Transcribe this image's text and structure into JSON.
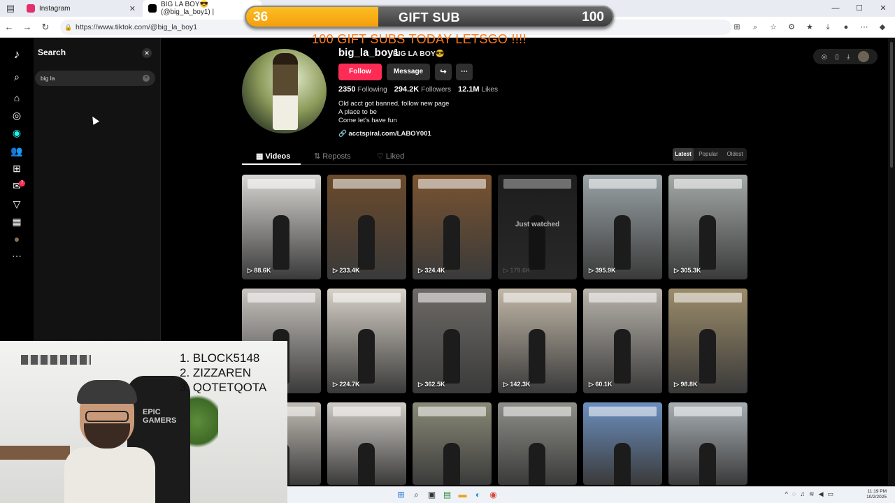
{
  "browser": {
    "tabs": [
      {
        "title": "Instagram",
        "active": false,
        "favicon_color": "#e1306c"
      },
      {
        "title": "BIG LA BOY😎 (@big_la_boy1) |",
        "active": true,
        "favicon_color": "#000000"
      }
    ],
    "url": "https://www.tiktok.com/@big_la_boy1",
    "window_controls": [
      "—",
      "☐",
      "✕"
    ]
  },
  "overlay": {
    "gift_current": "36",
    "gift_label": "GIFT SUB",
    "gift_goal": "100",
    "progress_fraction": 0.36,
    "banner": "100 GIFT SUBS TODAY LETSGO !!!!",
    "banner_color": "#ff7a1a",
    "leaderboard": [
      "1. BLOCK5148",
      "2. ZIZZAREN",
      "3. QOTETQOTA"
    ]
  },
  "sidebar": {
    "icons": [
      "tiktok-logo-icon",
      "search-icon",
      "home-icon",
      "explore-icon",
      "live-icon",
      "following-icon",
      "upload-icon",
      "messages-icon",
      "activity-icon",
      "creator-icon",
      "profile-icon",
      "more-icon"
    ],
    "messages_badge": "7"
  },
  "search": {
    "title": "Search",
    "query": "big la"
  },
  "profile": {
    "username": "big_la_boy1",
    "nickname": "BIG LA BOY😎",
    "follow_label": "Follow",
    "message_label": "Message",
    "stats": [
      {
        "value": "2350",
        "label": "Following"
      },
      {
        "value": "294.2K",
        "label": "Followers"
      },
      {
        "value": "12.1M",
        "label": "Likes"
      }
    ],
    "bio": [
      "Old acct got banned, follow new page",
      "A place to be",
      "Come let's have fun"
    ],
    "link": "acctspiral.com/LABOY001",
    "tabs": [
      "Videos",
      "Reposts",
      "Liked"
    ],
    "sort": [
      "Latest",
      "Popular",
      "Oldest"
    ]
  },
  "videos": [
    {
      "views": "88.6K",
      "bg": "#d8d6d2"
    },
    {
      "views": "233.4K",
      "bg": "#6b4a2c"
    },
    {
      "views": "324.4K",
      "bg": "#7a5330"
    },
    {
      "views": "179.6K",
      "bg": "#2a2a2a",
      "just_watched": "Just watched"
    },
    {
      "views": "395.9K",
      "bg": "#9aa3a6"
    },
    {
      "views": "305.3K",
      "bg": "#a4aaa8"
    },
    {
      "views": "",
      "bg": "#c8c4bf"
    },
    {
      "views": "224.7K",
      "bg": "#d8d2c8"
    },
    {
      "views": "362.5K",
      "bg": "#6d6a66"
    },
    {
      "views": "142.3K",
      "bg": "#c2b8a8"
    },
    {
      "views": "60.1K",
      "bg": "#b9b4ac"
    },
    {
      "views": "98.8K",
      "bg": "#9c8c6a"
    },
    {
      "views": "",
      "bg": "#c2bdb5"
    },
    {
      "views": "",
      "bg": "#d0ccc6"
    },
    {
      "views": "",
      "bg": "#8a8a78"
    },
    {
      "views": "",
      "bg": "#8e8f88"
    },
    {
      "views": "",
      "bg": "#6c8fbf"
    },
    {
      "views": "",
      "bg": "#a8b0b5"
    }
  ],
  "taskbar": {
    "icons": [
      "start-icon",
      "search-icon",
      "taskview-icon",
      "widgets-icon",
      "explorer-icon",
      "edge-icon",
      "chrome-icon"
    ],
    "time": "11:19 PM",
    "date": "10/2/2025"
  }
}
